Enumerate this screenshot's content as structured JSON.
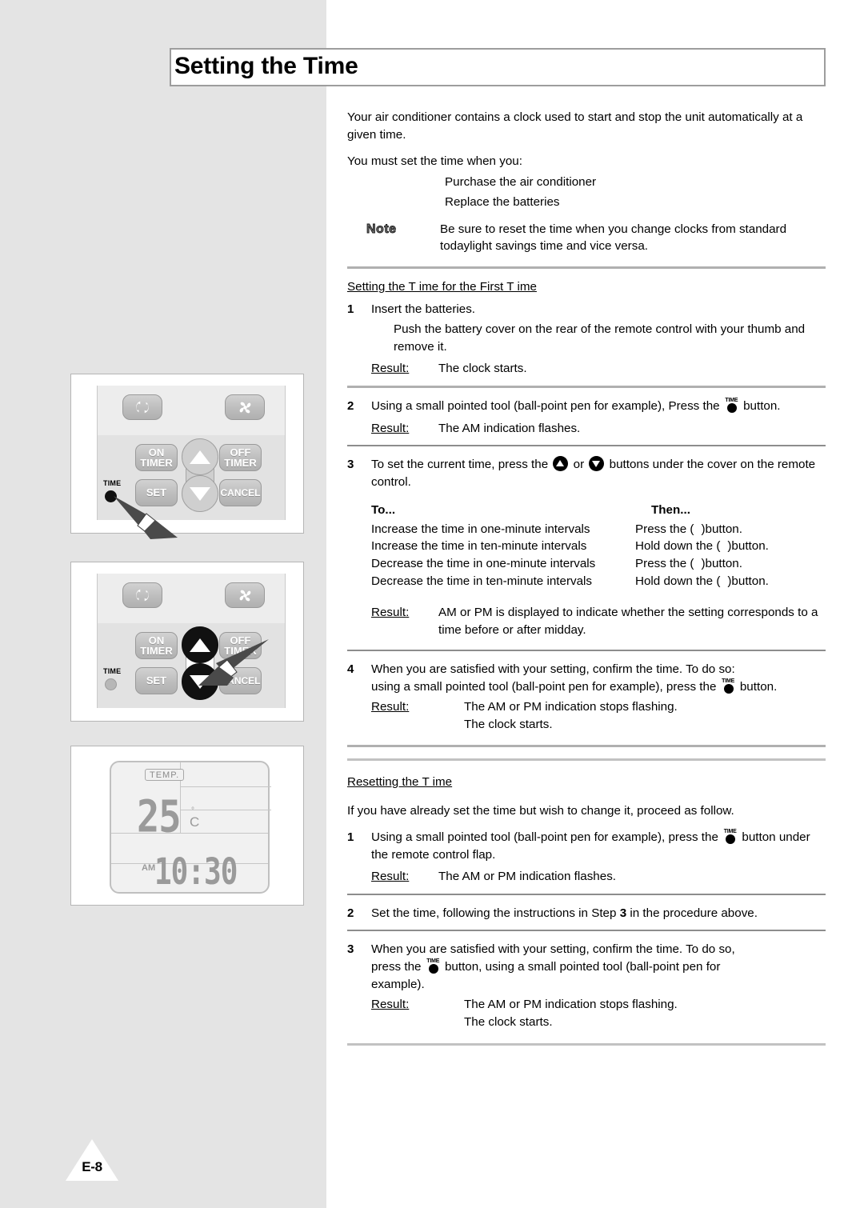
{
  "page": {
    "title": "Setting the Time",
    "page_marker": "E-8"
  },
  "intro": {
    "para1": "Your air conditioner contains a clock used to start and stop the unit automatically at a given time.",
    "para2": "You must set the time when you:",
    "bullets": [
      "Purchase the air conditioner",
      "Replace the batteries"
    ]
  },
  "note": {
    "label": "Note",
    "text": "Be sure to reset the time when you change clocks from standard todaylight savings time and vice versa."
  },
  "section_first": {
    "heading": "Setting the T ime for the First T ime",
    "step1": {
      "num": "1",
      "text": "Insert the batteries.",
      "sub": "Push the battery cover on the rear of the remote control with your thumb and remove it.",
      "result_label": "Result",
      "result_text": "The clock starts."
    },
    "step2": {
      "num": "2",
      "text_before": "Using a small pointed tool (ball-point pen for example), Press the",
      "text_after": "button.",
      "result_label": "Result",
      "result_text": "The AM indication flashes."
    },
    "step3": {
      "num": "3",
      "text_before": "To set the current time, press the",
      "text_middle": "or",
      "text_after": "buttons under the cover on the remote control.",
      "table": {
        "header": [
          "To...",
          "Then..."
        ],
        "rows": [
          [
            "Increase the time in one-minute intervals",
            "Press the (",
            ")button."
          ],
          [
            "Increase the time in ten-minute intervals",
            "Hold down the (",
            ")button."
          ],
          [
            "Decrease the time in one-minute intervals",
            "Press the (",
            ")button."
          ],
          [
            "Decrease the time in ten-minute intervals",
            "Hold down the (",
            ")button."
          ]
        ]
      },
      "result_label": "Result",
      "result_text": "AM or PM is displayed to indicate whether the setting corresponds to a time before or after midday."
    },
    "step4": {
      "num": "4",
      "line1": "When you are satisfied with your setting, confirm the time. To do so:",
      "line2_before": "using a small pointed tool (ball-point pen for example), press the",
      "line2_after": "button.",
      "result_label": "Result",
      "result_text1": "The AM or PM indication stops flashing.",
      "result_text2": "The clock starts."
    }
  },
  "section_reset": {
    "heading": "Resetting the T ime",
    "intro": "If you have already set the time but wish to change it, proceed as follow.",
    "step1": {
      "num": "1",
      "text_before": "Using a small pointed tool (ball-point pen for example), press the",
      "text_after": "button under the remote control flap.",
      "result_label": "Result",
      "result_text": "The AM or PM indication flashes."
    },
    "step2": {
      "num": "2",
      "text_before": "Set the time, following the instructions in Step",
      "bold_ref": "3",
      "text_after": "in the procedure above."
    },
    "step3": {
      "num": "3",
      "line1": "When you are satisfied with your setting, confirm the time. To do so,",
      "line2_before": "press the",
      "line2_after": "button, using a small pointed tool (ball-point pen for",
      "line3": "example).",
      "result_label": "Result",
      "result_text1": "The AM or PM indication stops flashing.",
      "result_text2": "The clock starts."
    }
  },
  "illustration1": {
    "caption_keys": {
      "swing": "swing-icon",
      "fan": "fan-icon",
      "on_timer": "ON\nTIMER",
      "off_timer": "OFF\nTIMER",
      "set": "SET",
      "cancel": "CANCEL",
      "time": "TIME"
    }
  },
  "illustration2": {
    "caption_keys": {
      "on_timer": "ON\nTIMER",
      "off_timer": "OFF\nTIMER",
      "set": "SET",
      "cancel": "CANCEL",
      "time": "TIME"
    }
  },
  "illustration3": {
    "temp_label": "TEMP.",
    "temp_value": "25",
    "degree": "°",
    "unit": "C",
    "meridiem": "AM",
    "clock": "10:30"
  },
  "keys": {
    "on_timer_l1": "ON",
    "on_timer_l2": "TIMER",
    "off_timer_l1": "OFF",
    "off_timer_l2": "TIMER",
    "set": "SET",
    "cancel": "CANCEL",
    "time": "TIME"
  },
  "colors": {
    "sidebar": "#e4e4e4",
    "rule": "#b0b0b0",
    "key_face": "#bdbdbd",
    "lcd_text": "#9a9a9a"
  }
}
